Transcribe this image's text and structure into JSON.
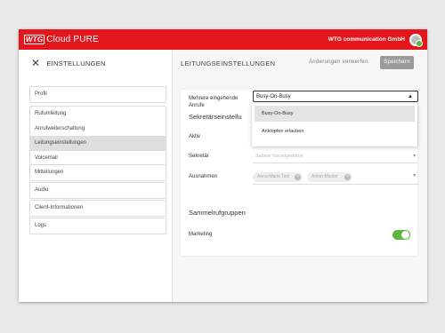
{
  "header": {
    "logo_brand": "WTG",
    "logo_text": "Cloud PURE",
    "company": "WTG communication GmbH",
    "accent_color": "#e3161c"
  },
  "sidebar": {
    "title": "EINSTELLUNGEN",
    "groups": [
      [
        "Profil"
      ],
      [
        "Rufumleitung",
        "Anrufweiterschaltung",
        "Leitungseinstellungen",
        "Voicemail"
      ],
      [
        "Mitteilungen"
      ],
      [
        "Audio"
      ],
      [
        "Client-Informationen"
      ],
      [
        "Logs"
      ]
    ],
    "active_item": "Leitungseinstellungen"
  },
  "main": {
    "title": "LEITUNGSEINSTELLUNGEN",
    "discard_label": "Änderungen verwerfen",
    "save_label": "Speichern",
    "multiple_calls_label": "Mehrere eingehende Anrufe",
    "multiple_calls_value": "Busy-On-Busy",
    "dropdown_options": [
      "Busy-On-Busy",
      "Anklopfen erlauben"
    ],
    "section_secretary": "Sekretärseinstellu",
    "active_label": "Aktiv",
    "secretary_label": "Sekretär",
    "secretary_placeholder": "Sabine Vorzeigedame",
    "exceptions_label": "Ausnahmen",
    "exceptions": [
      "Anna-Marie Test",
      "Anton Muster"
    ],
    "section_groups": "Sammelrufgruppen",
    "marketing_label": "Marketing",
    "marketing_on": true
  }
}
